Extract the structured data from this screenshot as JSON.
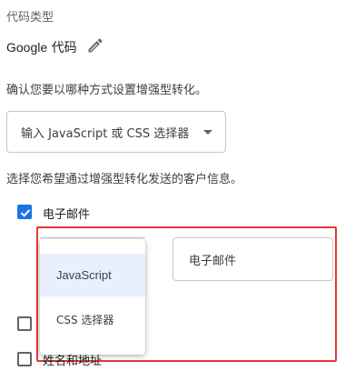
{
  "code_type": {
    "label": "代码类型",
    "value_prefix": "Google",
    "value_suffix": " 代码"
  },
  "method": {
    "question": "确认您要以哪种方式设置增强型转化。",
    "dropdown_value": "输入 JavaScript 或 CSS 选择器"
  },
  "customer_info": {
    "question": "选择您希望通过增强型转化发送的客户信息。",
    "options": [
      {
        "label": "电子邮件",
        "checked": true
      },
      {
        "label": "",
        "checked": false
      },
      {
        "label": "姓名和地址",
        "checked": false
      }
    ]
  },
  "email_input": {
    "placeholder": "电子邮件"
  },
  "menu": {
    "items": [
      {
        "label": "JavaScript",
        "selected": true
      },
      {
        "label": "CSS 选择器",
        "selected": false
      }
    ]
  },
  "colors": {
    "accent": "#1a73e8",
    "highlight": "#e53935",
    "selected_bg": "#e8f0fe"
  },
  "icons": {
    "edit": "pencil-icon",
    "checkmark": "check-icon",
    "dropdown_caret": "caret-down-icon"
  }
}
